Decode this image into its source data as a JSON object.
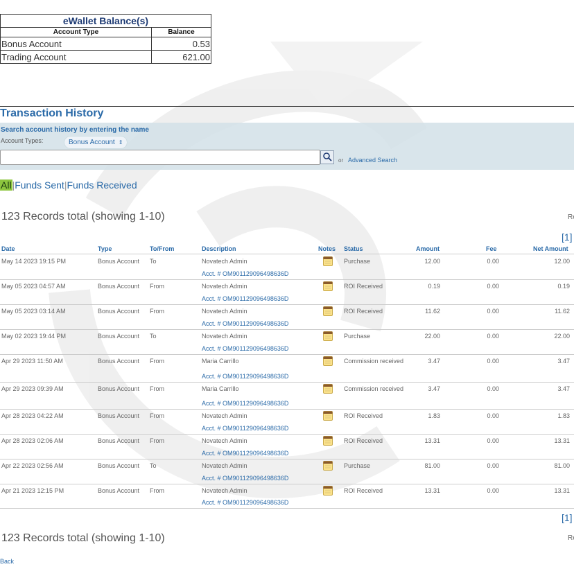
{
  "balance": {
    "title": "eWallet Balance(s)",
    "headers": [
      "Account Type",
      "Balance"
    ],
    "rows": [
      {
        "name": "Bonus Account",
        "value": "0.53"
      },
      {
        "name": "Trading Account",
        "value": "621.00"
      }
    ]
  },
  "history": {
    "title": "Transaction History",
    "search_label": "Search account history by entering the name",
    "account_types_label": "Account Types:",
    "account_select": "Bonus Account",
    "search_value": "",
    "or_text": "or",
    "advanced_search": "Advanced Search"
  },
  "filters": {
    "all": "All",
    "sent": "Funds Sent",
    "received": "Funds Received",
    "sep": "|"
  },
  "records_text": "123 Records total (showing 1-10)",
  "records_fragment": "Re",
  "pager": "[1]",
  "columns": {
    "date": "Date",
    "type": "Type",
    "to_from": "To/From",
    "description": "Description",
    "notes": "Notes",
    "status": "Status",
    "amount": "Amount",
    "fee": "Fee",
    "net": "Net Amount"
  },
  "transactions": [
    {
      "date": "May 14 2023 19:15 PM",
      "type": "Bonus Account",
      "to_from": "To",
      "desc": "Novatech Admin",
      "acct": "Acct. # OM901129096498636D",
      "status": "Purchase",
      "amount": "12.00",
      "fee": "0.00",
      "net": "12.00"
    },
    {
      "date": "May 05 2023 04:57 AM",
      "type": "Bonus Account",
      "to_from": "From",
      "desc": "Novatech Admin",
      "acct": "Acct. # OM901129096498636D",
      "status": "ROI Received",
      "amount": "0.19",
      "fee": "0.00",
      "net": "0.19"
    },
    {
      "date": "May 05 2023 03:14 AM",
      "type": "Bonus Account",
      "to_from": "From",
      "desc": "Novatech Admin",
      "acct": "Acct. # OM901129096498636D",
      "status": "ROI Received",
      "amount": "11.62",
      "fee": "0.00",
      "net": "11.62"
    },
    {
      "date": "May 02 2023 19:44 PM",
      "type": "Bonus Account",
      "to_from": "To",
      "desc": "Novatech Admin",
      "acct": "Acct. # OM901129096498636D",
      "status": "Purchase",
      "amount": "22.00",
      "fee": "0.00",
      "net": "22.00"
    },
    {
      "date": "Apr 29 2023 11:50 AM",
      "type": "Bonus Account",
      "to_from": "From",
      "desc": "Maria Carrillo",
      "acct": "Acct. # OM901129096498636D",
      "status": "Commission received",
      "amount": "3.47",
      "fee": "0.00",
      "net": "3.47"
    },
    {
      "date": "Apr 29 2023 09:39 AM",
      "type": "Bonus Account",
      "to_from": "From",
      "desc": "Maria Carrillo",
      "acct": "Acct. # OM901129096498636D",
      "status": "Commission received",
      "amount": "3.47",
      "fee": "0.00",
      "net": "3.47"
    },
    {
      "date": "Apr 28 2023 04:22 AM",
      "type": "Bonus Account",
      "to_from": "From",
      "desc": "Novatech Admin",
      "acct": "Acct. # OM901129096498636D",
      "status": "ROI Received",
      "amount": "1.83",
      "fee": "0.00",
      "net": "1.83"
    },
    {
      "date": "Apr 28 2023 02:06 AM",
      "type": "Bonus Account",
      "to_from": "From",
      "desc": "Novatech Admin",
      "acct": "Acct. # OM901129096498636D",
      "status": "ROI Received",
      "amount": "13.31",
      "fee": "0.00",
      "net": "13.31"
    },
    {
      "date": "Apr 22 2023 02:56 AM",
      "type": "Bonus Account",
      "to_from": "To",
      "desc": "Novatech Admin",
      "acct": "Acct. # OM901129096498636D",
      "status": "Purchase",
      "amount": "81.00",
      "fee": "0.00",
      "net": "81.00"
    },
    {
      "date": "Apr 21 2023 12:15 PM",
      "type": "Bonus Account",
      "to_from": "From",
      "desc": "Novatech Admin",
      "acct": "Acct. # OM901129096498636D",
      "status": "ROI Received",
      "amount": "13.31",
      "fee": "0.00",
      "net": "13.31"
    }
  ],
  "back": "Back",
  "icons": {
    "notes": "notepad-icon",
    "search": "search-icon"
  },
  "colors": {
    "link": "#2a6aa8",
    "active_filter": "#8dc63f",
    "panel": "#d2e0e8"
  }
}
